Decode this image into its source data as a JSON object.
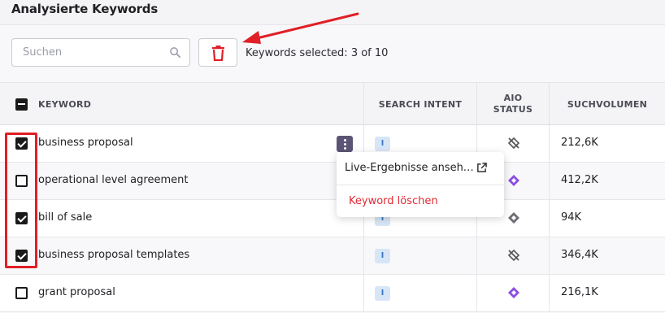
{
  "page": {
    "title": "Analysierte Keywords"
  },
  "toolbar": {
    "search_placeholder": "Suchen",
    "search_value": "",
    "selected_text": "Keywords selected: 3 of 10"
  },
  "table": {
    "headers": {
      "keyword": "KEYWORD",
      "search_intent": "SEARCH INTENT",
      "aio_status_line1": "AIO",
      "aio_status_line2": "STATUS",
      "volume": "SUCHVOLUMEN"
    },
    "rows": [
      {
        "keyword": "business proposal",
        "checked": true,
        "intent": "I",
        "aio": "hidden",
        "volume": "212,6K"
      },
      {
        "keyword": "operational level agreement",
        "checked": false,
        "intent": "I",
        "aio": "active",
        "volume": "412,2K"
      },
      {
        "keyword": "bill of sale",
        "checked": true,
        "intent": "I",
        "aio": "grey",
        "volume": "94K"
      },
      {
        "keyword": "business proposal templates",
        "checked": true,
        "intent": "I",
        "aio": "hidden",
        "volume": "346,4K"
      },
      {
        "keyword": "grant proposal",
        "checked": false,
        "intent": "I",
        "aio": "active",
        "volume": "216,1K"
      }
    ]
  },
  "context_menu": {
    "view_live": "Live-Ergebnisse anseh…",
    "delete": "Keyword löschen"
  },
  "colors": {
    "accent_red": "#e01f26",
    "aio_active": "#8b4fe0",
    "intent_badge": "#d7e6f7"
  },
  "icons": {
    "search": "search-icon",
    "trash": "trash-icon",
    "more": "more-vertical-icon",
    "external": "external-link-icon",
    "aio_hidden": "eye-off-icon",
    "aio_active": "ai-diamond-icon"
  }
}
